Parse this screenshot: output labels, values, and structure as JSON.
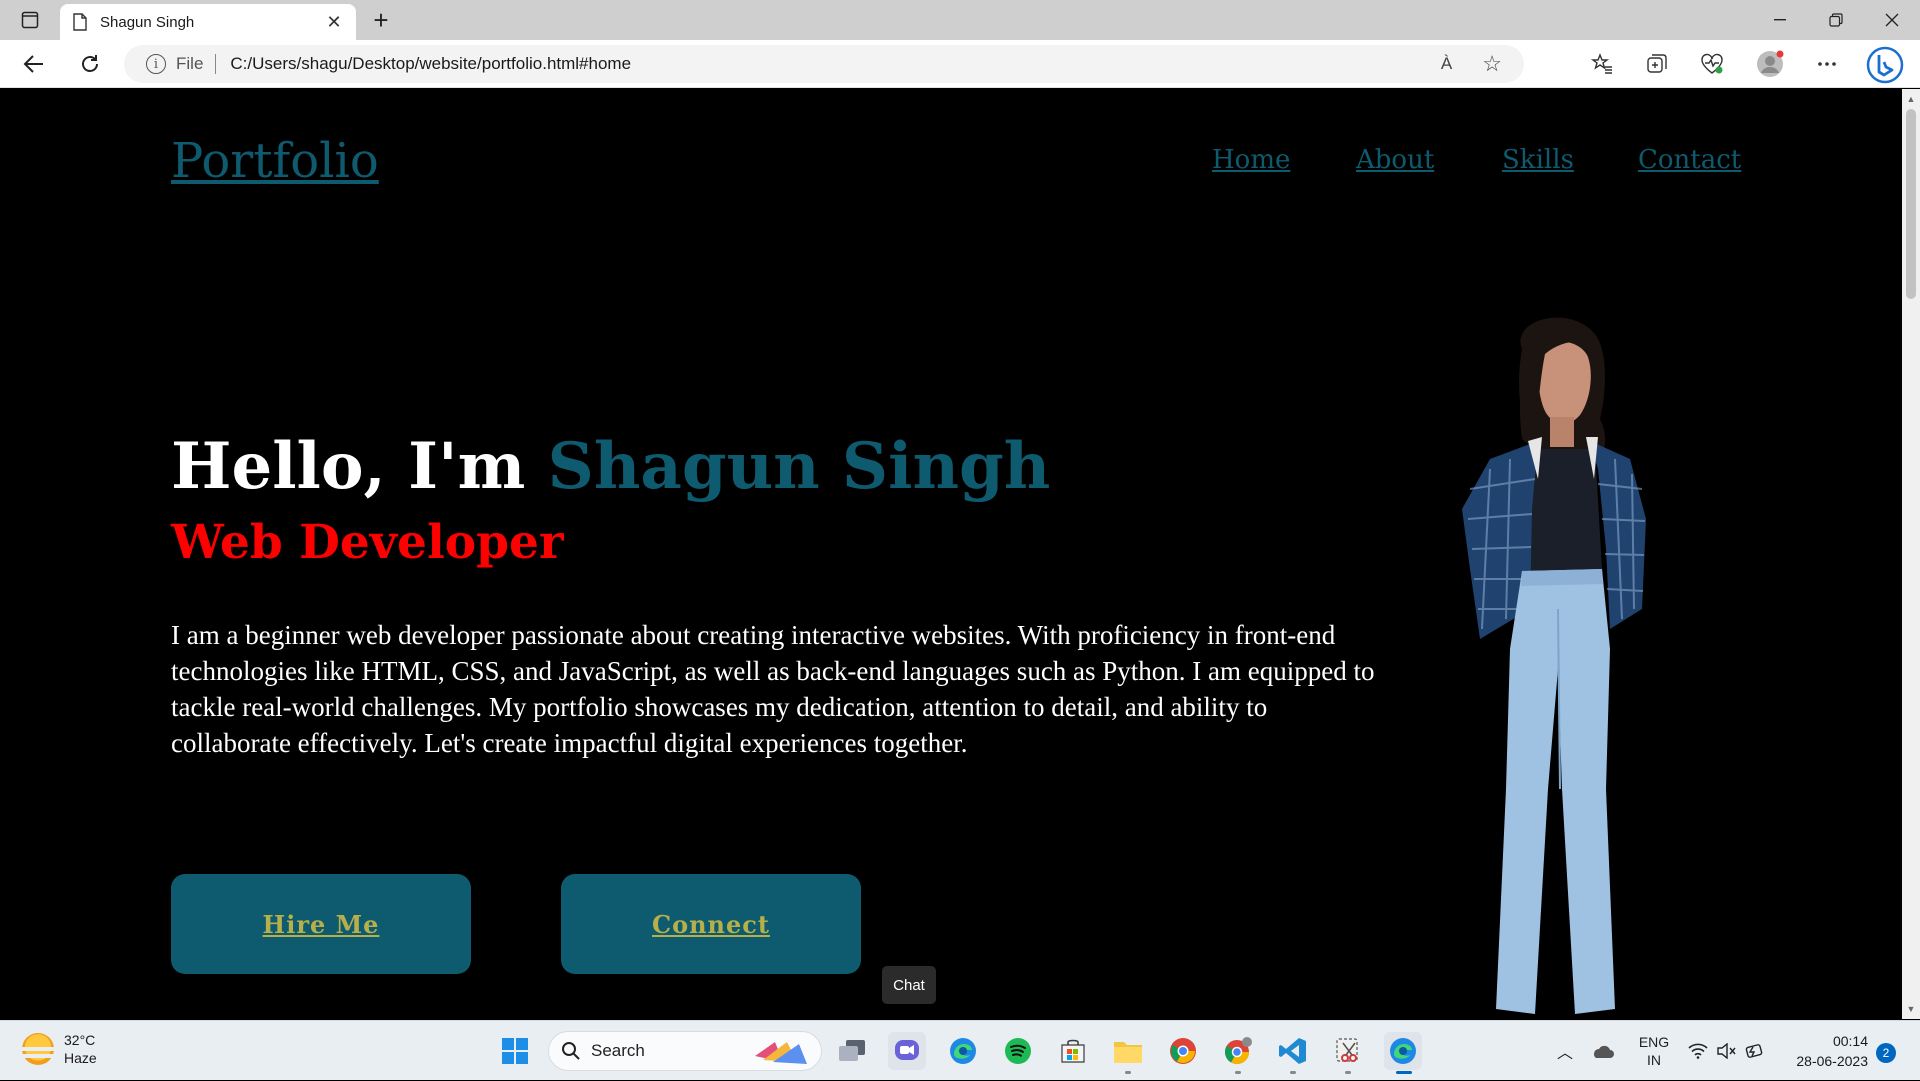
{
  "browser": {
    "tab_title": "Shagun Singh",
    "address_scheme": "File",
    "address_url": "C:/Users/shagu/Desktop/website/portfolio.html#home",
    "read_aloud": "À",
    "new_tab_symbol": "+",
    "tab_close_symbol": "✕"
  },
  "site": {
    "logo": "Portfolio",
    "nav": [
      {
        "label": "Home"
      },
      {
        "label": "About"
      },
      {
        "label": "Skills"
      },
      {
        "label": "Contact"
      }
    ],
    "hero": {
      "greeting": "Hello, I'm ",
      "name": "Shagun Singh",
      "role": "Web Developer",
      "bio": "I am a beginner web developer passionate about creating interactive websites. With proficiency in front-end technologies like HTML, CSS, and JavaScript, as well as back-end languages such as Python. I am equipped to tackle real-world challenges. My portfolio showcases my dedication, attention to detail, and ability to collaborate effectively. Let's create impactful digital experiences together."
    },
    "buttons": {
      "hire": "Hire Me",
      "connect": "Connect"
    },
    "colors": {
      "accent": "#0e5b6f",
      "role": "#ff0000",
      "button_text": "#b7b04a",
      "background": "#000000"
    }
  },
  "tooltip": {
    "chat": "Chat"
  },
  "taskbar": {
    "weather_temp": "32°C",
    "weather_desc": "Haze",
    "search_label": "Search",
    "language_top": "ENG",
    "language_bottom": "IN",
    "time": "00:14",
    "date": "28-06-2023",
    "notification_count": "2"
  }
}
